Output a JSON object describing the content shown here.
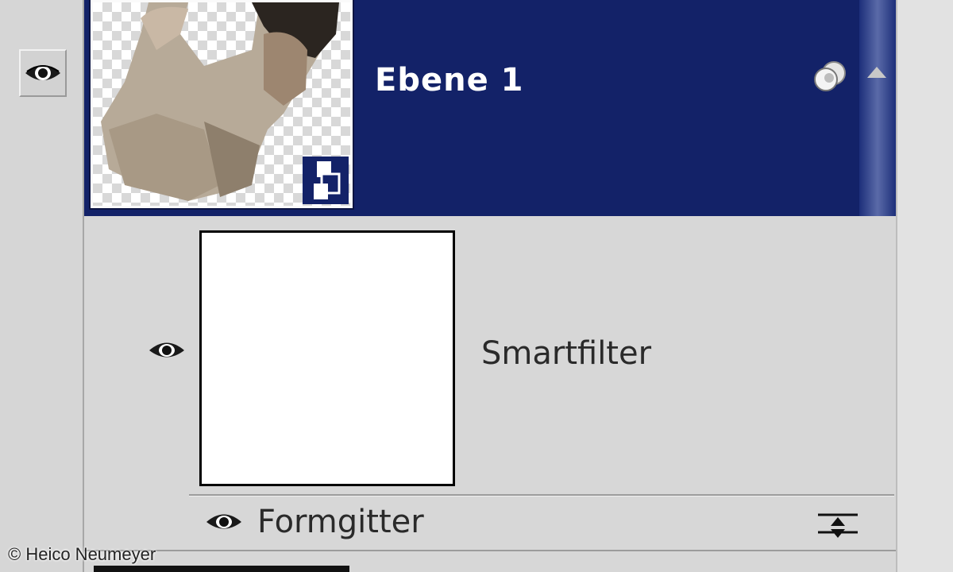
{
  "layer": {
    "name": "Ebene 1",
    "selected": true
  },
  "smart_filter": {
    "label": "Smartfilter"
  },
  "filter": {
    "name": "Formgitter"
  },
  "credit": "© Heico Neumeyer",
  "icons": {
    "visibility": "eye-icon",
    "smart_object": "smart-object-badge-icon",
    "effects": "layer-effects-icon",
    "blend_options": "blending-options-icon",
    "scroll_up": "scroll-up-arrow-icon"
  },
  "colors": {
    "selection": "#132268",
    "panel": "#d7d7d7"
  }
}
